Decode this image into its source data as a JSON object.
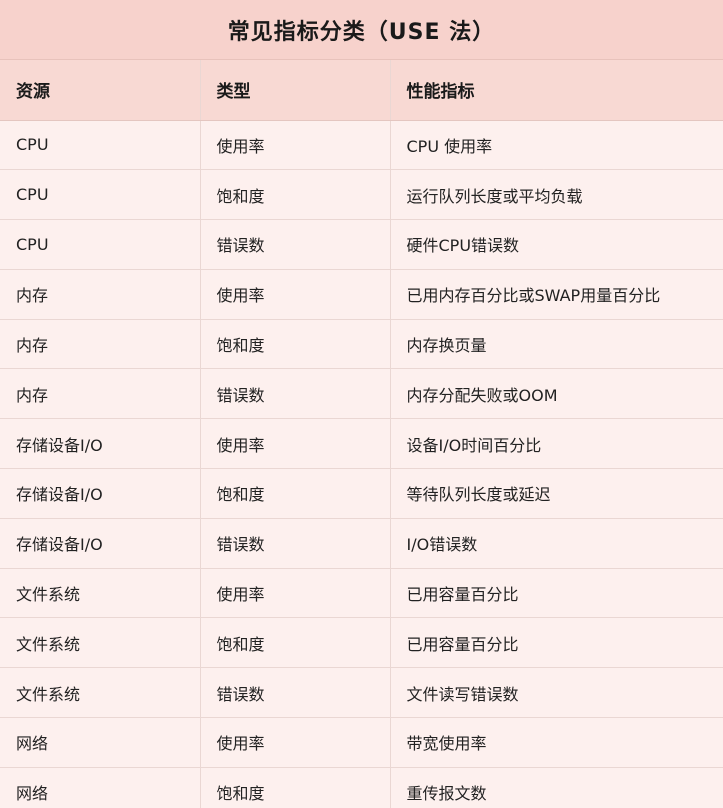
{
  "title": "常见指标分类（USE 法）",
  "columns": [
    "资源",
    "类型",
    "性能指标"
  ],
  "rows": [
    [
      "CPU",
      "使用率",
      "CPU 使用率"
    ],
    [
      "CPU",
      "饱和度",
      "运行队列长度或平均负载"
    ],
    [
      "CPU",
      "错误数",
      "硬件CPU错误数"
    ],
    [
      "内存",
      "使用率",
      "已用内存百分比或SWAP用量百分比"
    ],
    [
      "内存",
      "饱和度",
      "内存换页量"
    ],
    [
      "内存",
      "错误数",
      "内存分配失败或OOM"
    ],
    [
      "存储设备I/O",
      "使用率",
      "设备I/O时间百分比"
    ],
    [
      "存储设备I/O",
      "饱和度",
      "等待队列长度或延迟"
    ],
    [
      "存储设备I/O",
      "错误数",
      "I/O错误数"
    ],
    [
      "文件系统",
      "使用率",
      "已用容量百分比"
    ],
    [
      "文件系统",
      "饱和度",
      "已用容量百分比"
    ],
    [
      "文件系统",
      "错误数",
      "文件读写错误数"
    ],
    [
      "网络",
      "使用率",
      "带宽使用率"
    ],
    [
      "网络",
      "饱和度",
      "重传报文数"
    ]
  ]
}
